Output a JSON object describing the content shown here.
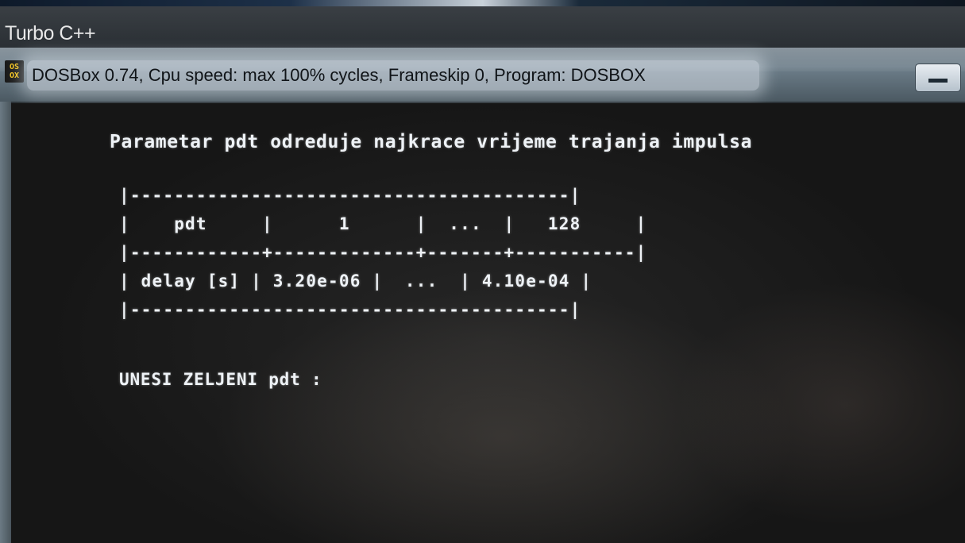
{
  "backdrop_window": {
    "title": "Turbo C++"
  },
  "dosbox_window": {
    "icon_lines": [
      "OS",
      "OX"
    ],
    "title": "DOSBox 0.74, Cpu speed: max 100% cycles, Frameskip  0, Program:  DOSBOX"
  },
  "console": {
    "heading": "Parametar pdt odreduje najkrace vrijeme trajanja impulsa",
    "table_lines": [
      "|----------------------------------------|",
      "|    pdt     |      1      |  ...  |   128     |",
      "|------------+-------------+-------+-----------|",
      "| delay [s] | 3.20e-06 |  ...  | 4.10e-04 |",
      "|----------------------------------------|"
    ],
    "prompt": "UNESI ZELJENI pdt :"
  }
}
